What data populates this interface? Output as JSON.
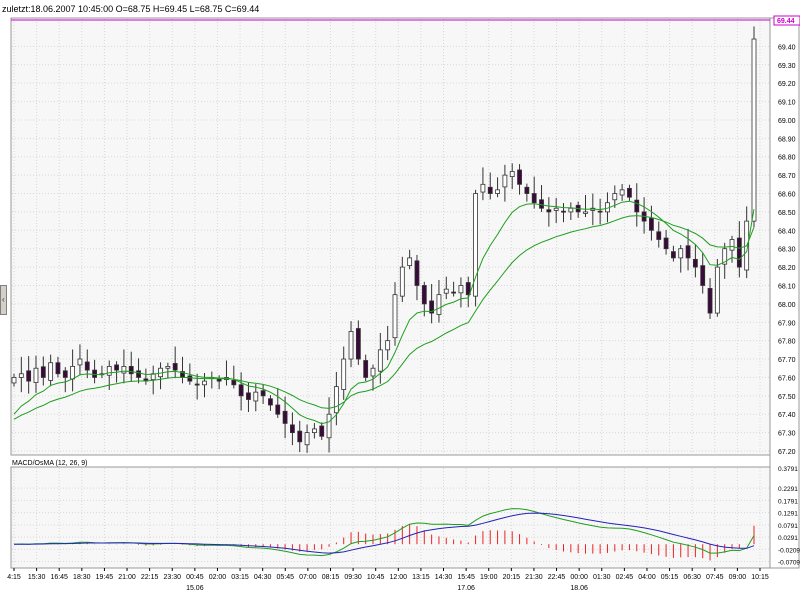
{
  "header": {
    "text": "zuletzt:18.06.2007 10:45:00 O=68.75 H=69.45 L=68.75 C=69.44"
  },
  "colors": {
    "background": "#f7f7f7",
    "grid": "#d8d8d8",
    "last_price_line": "#cc00cc",
    "candle_up_fill": "#ffffff",
    "candle_down_fill": "#3a0a3a",
    "candle_outline": "#333333",
    "ma": "#1e9e1e",
    "macd_line": "#1e9e1e",
    "signal_line": "#2222bb",
    "histogram": "#ee2222"
  },
  "chart_data": [
    {
      "type": "candlestick",
      "last_price_label": "69.44",
      "y_range": [
        67.2,
        69.5
      ],
      "y_ticks": [
        "67.20",
        "67.30",
        "67.40",
        "67.50",
        "67.60",
        "67.70",
        "67.80",
        "67.90",
        "68.00",
        "68.10",
        "68.20",
        "68.30",
        "68.40",
        "68.50",
        "68.60",
        "68.70",
        "68.80",
        "68.90",
        "69.00",
        "69.10",
        "69.20",
        "69.30",
        "69.40"
      ],
      "closes": [
        67.6,
        67.62,
        67.58,
        67.65,
        67.6,
        67.68,
        67.62,
        67.6,
        67.66,
        67.7,
        67.64,
        67.6,
        67.62,
        67.66,
        67.64,
        67.66,
        67.62,
        67.6,
        67.58,
        67.62,
        67.65,
        67.66,
        67.64,
        67.6,
        67.58,
        67.56,
        67.58,
        67.6,
        67.58,
        67.6,
        67.56,
        67.5,
        67.48,
        67.52,
        67.5,
        67.45,
        67.4,
        67.35,
        67.3,
        67.25,
        67.3,
        67.32,
        67.28,
        67.4,
        67.55,
        67.7,
        67.85,
        67.7,
        67.6,
        67.65,
        67.75,
        67.8,
        68.05,
        68.2,
        68.25,
        68.1,
        68.0,
        67.95,
        68.05,
        68.08,
        68.06,
        68.1,
        68.05,
        68.6,
        68.65,
        68.6,
        68.62,
        68.7,
        68.72,
        68.65,
        68.6,
        68.55,
        68.52,
        68.5,
        68.52,
        68.5,
        68.52,
        68.5,
        68.5,
        68.52,
        68.5,
        68.55,
        68.6,
        68.62,
        68.58,
        68.5,
        68.45,
        68.4,
        68.35,
        68.3,
        68.25,
        68.3,
        68.25,
        68.2,
        68.1,
        67.95,
        68.2,
        68.3,
        68.35,
        68.2,
        68.45,
        69.44
      ],
      "ma": {
        "start": 67.35,
        "smoothing": 0.2
      },
      "ma2": {
        "smoothing": 0.09
      }
    },
    {
      "type": "macd",
      "title": "MACD/OsMA (12, 26, 9)",
      "y_range": [
        -0.085,
        0.295
      ],
      "y_ticks": [
        "0.3791",
        "0.2291",
        "0.1791",
        "0.1291",
        "0.0791",
        "0.0291",
        "-0.0209",
        "-0.0709"
      ],
      "x_tick_labels": [
        "4:15",
        "15:30",
        "16:45",
        "18:30",
        "19:45",
        "21:00",
        "22:15",
        "23:30",
        "00:45",
        "02:00",
        "03:15",
        "04:30",
        "05:45",
        "07:00",
        "08:15",
        "09:30",
        "10:45",
        "12:00",
        "13:15",
        "14:30",
        "15:45",
        "19:00",
        "20:15",
        "21:30",
        "22:45",
        "00:00",
        "01:30",
        "02:45",
        "04:00",
        "05:15",
        "06:30",
        "07:45",
        "09:00",
        "10:15"
      ],
      "date_labels": [
        {
          "label": "15.06",
          "tick": 8
        },
        {
          "label": "17.06",
          "tick": 20
        },
        {
          "label": "18.06",
          "tick": 25
        }
      ]
    }
  ]
}
